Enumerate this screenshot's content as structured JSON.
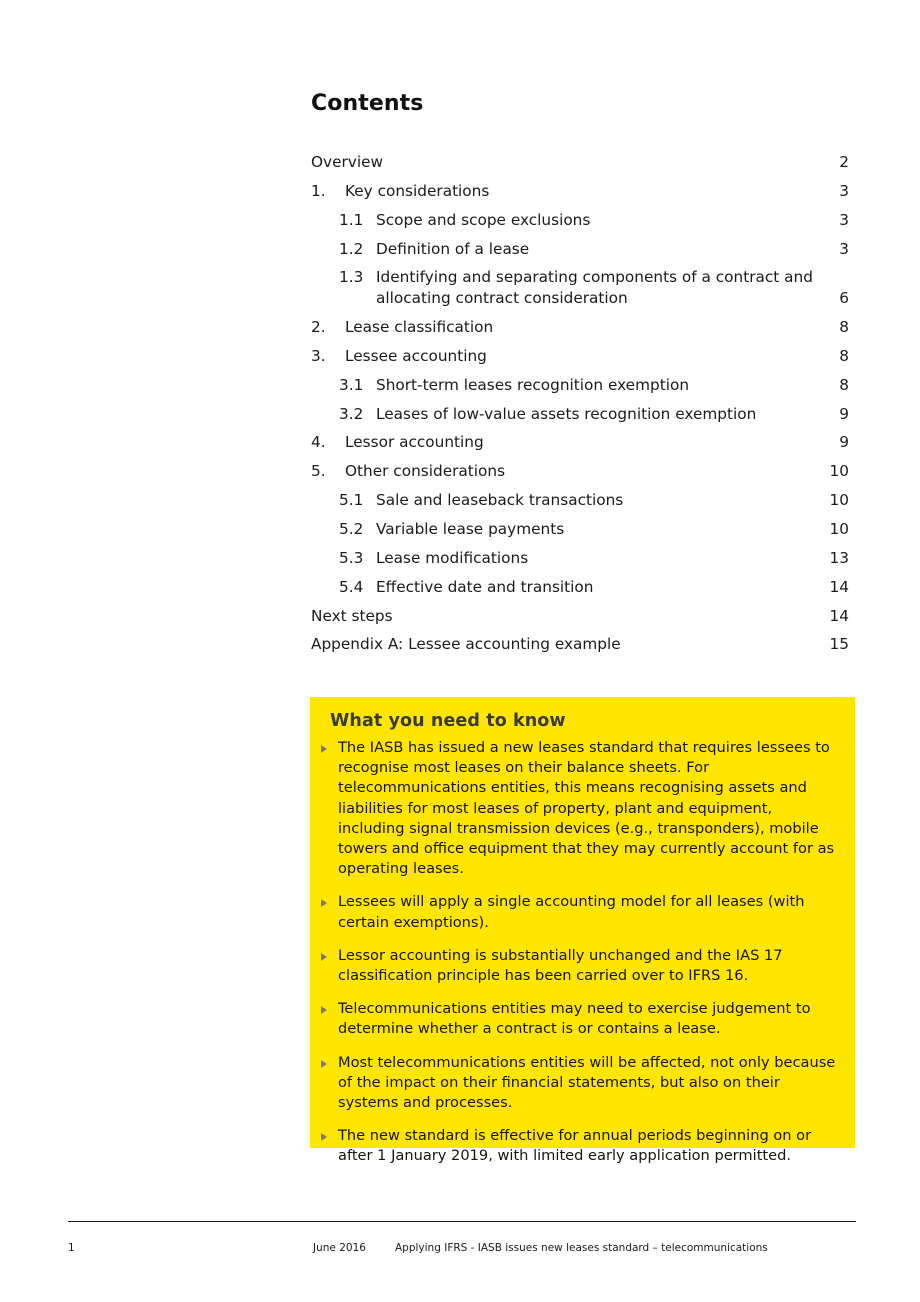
{
  "document": {
    "heading": "Contents"
  },
  "toc": {
    "entries": [
      {
        "num": "",
        "label": "Overview",
        "page": "2",
        "level": 0
      },
      {
        "num": "1.",
        "label": "Key considerations",
        "page": "3",
        "level": 0
      },
      {
        "num": "1.1",
        "label": "Scope and scope exclusions",
        "page": "3",
        "level": 1
      },
      {
        "num": "1.2",
        "label": "Definition of a lease",
        "page": "3",
        "level": 1
      },
      {
        "num": "1.3",
        "label": "Identifying and separating components of a contract and allocating contract consideration",
        "page": "6",
        "level": 1
      },
      {
        "num": "2.",
        "label": "Lease classification",
        "page": "8",
        "level": 0
      },
      {
        "num": "3.",
        "label": "Lessee accounting",
        "page": "8",
        "level": 0
      },
      {
        "num": "3.1",
        "label": "Short-term leases recognition exemption",
        "page": "8",
        "level": 1
      },
      {
        "num": "3.2",
        "label": "Leases of low-value assets recognition exemption",
        "page": "9",
        "level": 1
      },
      {
        "num": "4.",
        "label": "Lessor accounting",
        "page": "9",
        "level": 0
      },
      {
        "num": "5.",
        "label": "Other considerations",
        "page": "10",
        "level": 0
      },
      {
        "num": "5.1",
        "label": "Sale and leaseback transactions",
        "page": "10",
        "level": 1
      },
      {
        "num": "5.2",
        "label": "Variable lease payments",
        "page": "10",
        "level": 1
      },
      {
        "num": "5.3",
        "label": "Lease modifications",
        "page": "13",
        "level": 1
      },
      {
        "num": "5.4",
        "label": "Effective date and transition",
        "page": "14",
        "level": 1
      },
      {
        "num": "",
        "label": "Next steps",
        "page": "14",
        "level": 0
      },
      {
        "num": "",
        "label": "Appendix A: Lessee accounting example",
        "page": "15",
        "level": 0
      }
    ]
  },
  "callout": {
    "title": "What you need to know",
    "background_color": "#ffe600",
    "bullet_icon": "triangle-right-icon",
    "bullets": [
      "The IASB has issued a new leases standard that requires lessees to recognise most leases on their balance sheets. For telecommunications entities, this means recognising assets and liabilities for most leases of property, plant and equipment, including signal transmission devices (e.g., transponders), mobile towers and office equipment that they may currently account for as operating leases.",
      "Lessees will apply a single accounting model for all leases (with certain exemptions).",
      "Lessor accounting is substantially unchanged and the IAS 17 classification principle has been carried over to IFRS 16.",
      "Telecommunications entities may need to exercise judgement to determine whether a contract is or contains a lease.",
      "Most telecommunications entities will be affected, not only because of the impact on their financial statements, but also on their systems and processes.",
      "The new standard is effective for annual periods beginning on or after 1 January 2019, with limited early application permitted."
    ]
  },
  "footer": {
    "page_number": "1",
    "date": "June 2016",
    "title": "Applying IFRS - IASB issues new leases standard – telecommunications"
  }
}
